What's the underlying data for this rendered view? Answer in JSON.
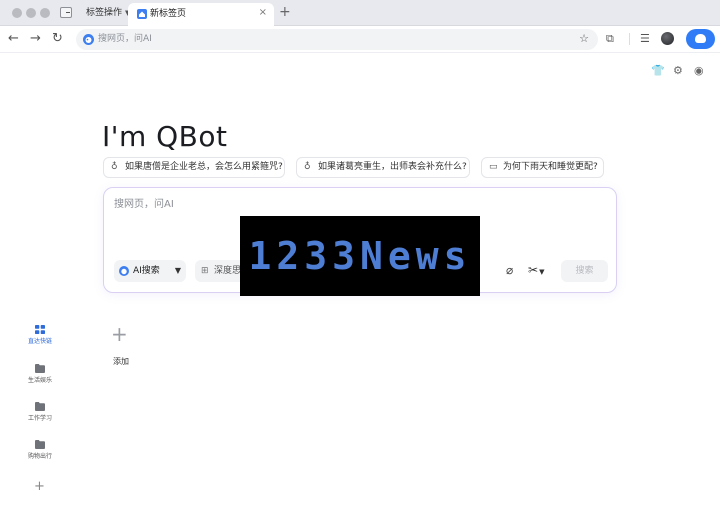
{
  "browser": {
    "tab_menu_label": "标签操作",
    "active_tab_title": "新标签页",
    "tab_close": "×",
    "new_tab": "+",
    "address_placeholder": "搜网页，问AI"
  },
  "page": {
    "title": "I'm QBot",
    "suggestions": [
      {
        "icon": "bulb-icon",
        "label": "如果唐僧是企业老总，会怎么用紧箍咒?"
      },
      {
        "icon": "bulb-icon",
        "label": "如果诸葛亮重生，出师表会补充什么?"
      },
      {
        "icon": "chat-icon",
        "label": "为何下雨天和睡觉更配?"
      }
    ],
    "search": {
      "placeholder": "搜网页，问AI",
      "mode_label": "AI搜索",
      "deep_label": "深度思考",
      "submit_label": "搜索"
    },
    "watermark": "1233News",
    "add_shortcut_label": "添加"
  },
  "sidebar": {
    "items": [
      {
        "label": "直达快链",
        "active": true,
        "icon": "grid-icon"
      },
      {
        "label": "生活娱乐",
        "active": false,
        "icon": "folder-icon"
      },
      {
        "label": "工作学习",
        "active": false,
        "icon": "folder-icon"
      },
      {
        "label": "购物出行",
        "active": false,
        "icon": "folder-icon"
      }
    ],
    "add": "+"
  },
  "colors": {
    "accent": "#2f7cf6",
    "search_border": "#d9d0f3",
    "watermark_text": "#4e7ed4"
  }
}
